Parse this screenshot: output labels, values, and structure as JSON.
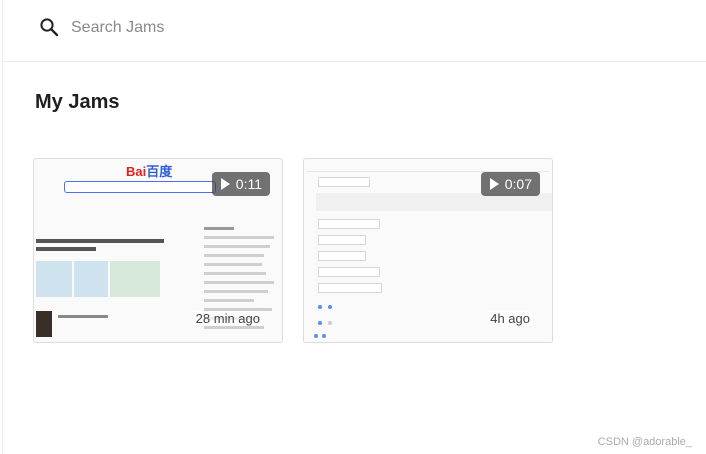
{
  "search": {
    "placeholder": "Search Jams"
  },
  "section": {
    "title": "My Jams"
  },
  "jams": [
    {
      "duration": "0:11",
      "age": "28 min ago"
    },
    {
      "duration": "0:07",
      "age": "4h ago"
    }
  ],
  "thumbnail_1": {
    "logo_a": "Bai",
    "logo_b": "百度"
  },
  "watermark": "CSDN @adorable_",
  "colors": {
    "accent": "#2e5fd8",
    "badge_bg": "#3c3c3c"
  }
}
